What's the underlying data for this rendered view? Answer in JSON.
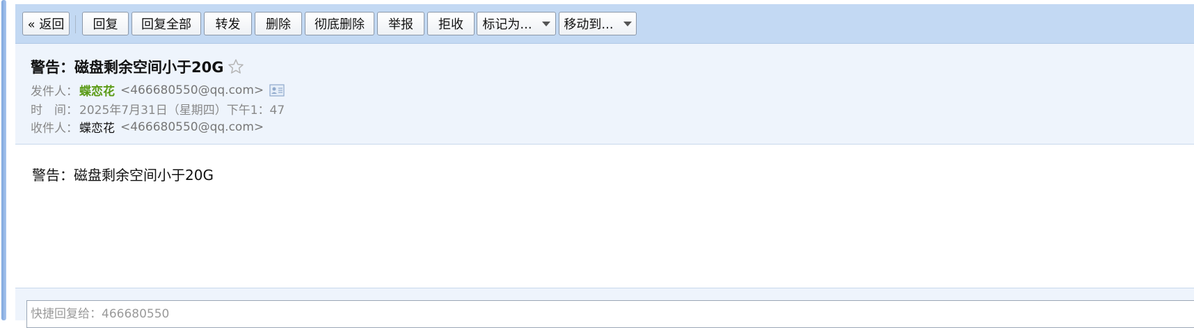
{
  "toolbar": {
    "back_label": "« 返回",
    "reply_label": "回复",
    "reply_all_label": "回复全部",
    "forward_label": "转发",
    "delete_label": "删除",
    "delete_permanent_label": "彻底删除",
    "report_label": "举报",
    "reject_label": "拒收",
    "mark_as_label": "标记为...",
    "move_to_label": "移动到..."
  },
  "email": {
    "subject": "警告：磁盘剩余空间小于20G",
    "sender_label": "发件人：",
    "sender_name": "蝶恋花",
    "sender_address": "<466680550@qq.com>",
    "time_label": "时　间：",
    "time_value": "2025年7月31日（星期四）下午1：47",
    "recipient_label": "收件人：",
    "recipient_name": "蝶恋花",
    "recipient_address": "<466680550@qq.com>",
    "body": "警告：磁盘剩余空间小于20G"
  },
  "quick_reply": {
    "placeholder": "快捷回复给：466680550"
  },
  "colors": {
    "toolbar_bg": "#c3d9f3",
    "header_bg": "#eef4fc",
    "sender_name": "#5a9a14"
  },
  "icons": {
    "star": "star-icon",
    "contact_card": "contact-card-icon",
    "dropdown": "chevron-down-icon"
  }
}
